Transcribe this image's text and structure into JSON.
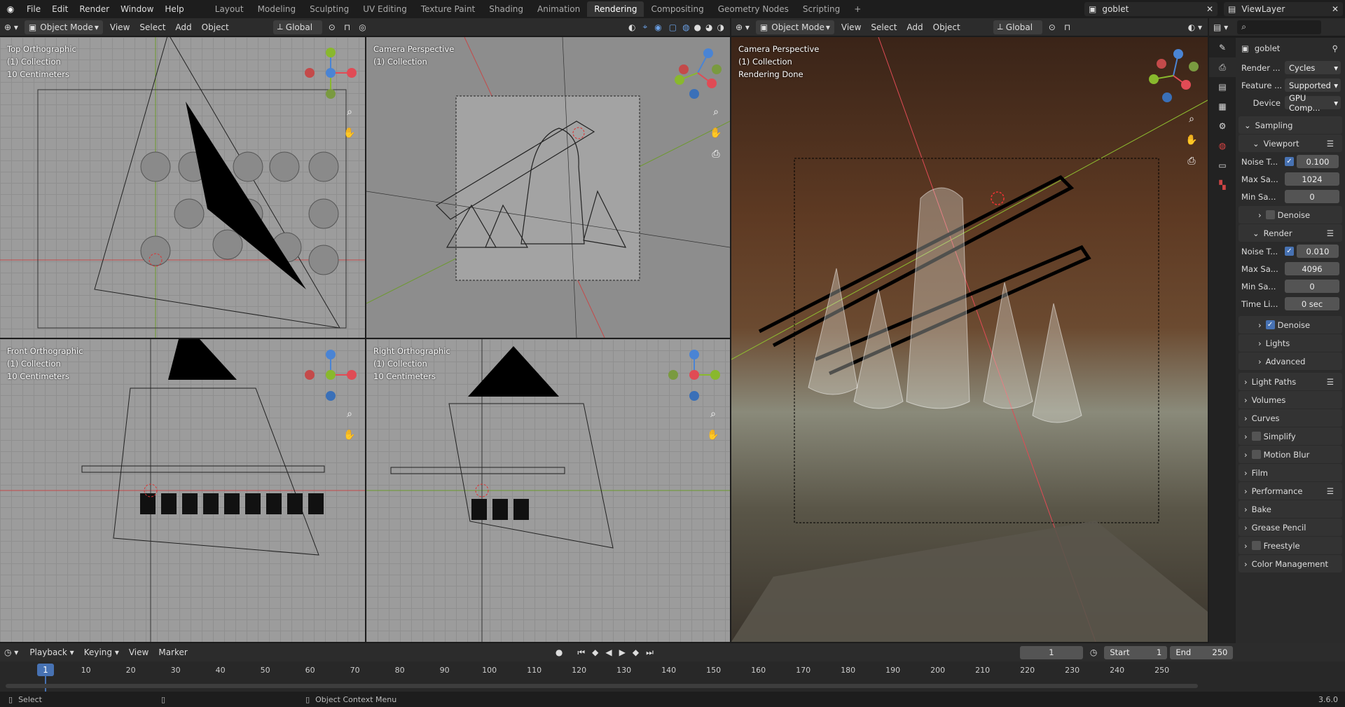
{
  "top_menu": [
    "File",
    "Edit",
    "Render",
    "Window",
    "Help"
  ],
  "workspaces": [
    "Layout",
    "Modeling",
    "Sculpting",
    "UV Editing",
    "Texture Paint",
    "Shading",
    "Animation",
    "Rendering",
    "Compositing",
    "Geometry Nodes",
    "Scripting",
    "+"
  ],
  "active_workspace": "Rendering",
  "scene_name": "goblet",
  "view_layer": "ViewLayer",
  "left_header": {
    "mode": "Object Mode",
    "menus": [
      "View",
      "Select",
      "Add",
      "Object"
    ],
    "orientation": "Global"
  },
  "right_header": {
    "mode": "Object Mode",
    "menus": [
      "View",
      "Select",
      "Add",
      "Object"
    ],
    "orientation": "Global"
  },
  "viewports": {
    "top": {
      "l1": "Top Orthographic",
      "l2": "(1) Collection",
      "l3": "10 Centimeters"
    },
    "camera": {
      "l1": "Camera Perspective",
      "l2": "(1) Collection"
    },
    "front": {
      "l1": "Front Orthographic",
      "l2": "(1) Collection",
      "l3": "10 Centimeters"
    },
    "right": {
      "l1": "Right Orthographic",
      "l2": "(1) Collection",
      "l3": "10 Centimeters"
    },
    "render": {
      "l1": "Camera Perspective",
      "l2": "(1) Collection",
      "l3": "Rendering Done"
    }
  },
  "axis_labels": {
    "x": "X",
    "y": "Y",
    "z": "Z"
  },
  "properties": {
    "object_name": "goblet",
    "render_engine_label": "Render ...",
    "render_engine": "Cycles",
    "feature_label": "Feature ...",
    "feature": "Supported",
    "device_label": "Device",
    "device": "GPU Comp...",
    "sampling": "Sampling",
    "viewport": "Viewport",
    "noise_label": "Noise T...",
    "vp_noise": "0.100",
    "max_label": "Max Sa...",
    "vp_max": "1024",
    "min_label": "Min Sa...",
    "vp_min": "0",
    "denoise": "Denoise",
    "render": "Render",
    "r_noise": "0.010",
    "r_max": "4096",
    "r_min": "0",
    "time_label": "Time Li...",
    "r_time": "0 sec",
    "sections": [
      "Light Paths",
      "Volumes",
      "Curves",
      "Simplify",
      "Motion Blur",
      "Film",
      "Performance",
      "Bake",
      "Grease Pencil",
      "Freestyle",
      "Color Management"
    ],
    "sub_sections": [
      "Lights",
      "Advanced"
    ]
  },
  "timeline": {
    "menus": [
      "Playback",
      "Keying",
      "View",
      "Marker"
    ],
    "current_frame": "1",
    "start_label": "Start",
    "start": "1",
    "end_label": "End",
    "end": "250",
    "ticks": [
      "10",
      "20",
      "30",
      "40",
      "50",
      "60",
      "70",
      "80",
      "90",
      "100",
      "110",
      "120",
      "130",
      "140",
      "150",
      "160",
      "170",
      "180",
      "190",
      "200",
      "210",
      "220",
      "230",
      "240",
      "250"
    ],
    "playhead": "1"
  },
  "status": {
    "select": "Select",
    "context": "Object Context Menu",
    "version": "3.6.0"
  },
  "colors": {
    "accent": "#4772b3",
    "x_axis": "#e04b55",
    "y_axis": "#89b82d",
    "z_axis": "#4a84d4"
  }
}
